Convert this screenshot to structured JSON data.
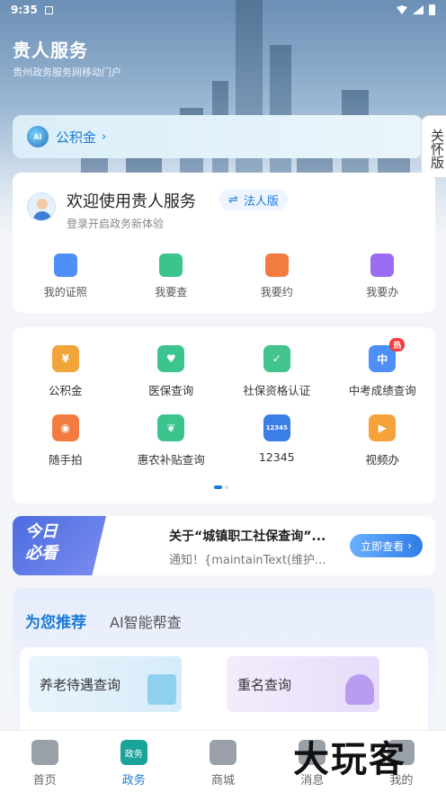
{
  "status_bar": {
    "time": "9:35",
    "notif_glyph": "A"
  },
  "header": {
    "title": "贵人服务",
    "subtitle": "贵州政务服务网移动门户"
  },
  "care_mode": {
    "label": "关怀版"
  },
  "fund_bar": {
    "ai_badge": "AI",
    "label": "公积金",
    "chevron": "›"
  },
  "welcome": {
    "title": "欢迎使用贵人服务",
    "legal_label": "法人版",
    "legal_icon": "⇌",
    "subtitle": "登录开启政务新体验",
    "quick": [
      {
        "label": "我的证照",
        "icon": "id-card-icon",
        "color": "#4e8ef7"
      },
      {
        "label": "我要查",
        "icon": "search-doc-icon",
        "color": "#3cc48f"
      },
      {
        "label": "我要约",
        "icon": "calendar-icon",
        "color": "#f27b3f"
      },
      {
        "label": "我要办",
        "icon": "task-icon",
        "color": "#9a6cf2"
      }
    ]
  },
  "services": {
    "items": [
      {
        "label": "公积金",
        "icon": "fund-icon",
        "glyph": "¥",
        "color": "#f0a43a"
      },
      {
        "label": "医保查询",
        "icon": "medical-card-icon",
        "glyph": "♥",
        "color": "#3cc48f"
      },
      {
        "label": "社保资格认证",
        "icon": "verify-icon",
        "glyph": "✓",
        "color": "#43c48c"
      },
      {
        "label": "中考成绩查询",
        "icon": "exam-score-icon",
        "glyph": "中",
        "color": "#4e8ef7",
        "badge": "热"
      },
      {
        "label": "随手拍",
        "icon": "camera-icon",
        "glyph": "◉",
        "color": "#f27b3f"
      },
      {
        "label": "惠农补贴查询",
        "icon": "plant-icon",
        "glyph": "❦",
        "color": "#3cc48f"
      },
      {
        "label": "12345",
        "icon": "hotline-icon",
        "glyph": "12345",
        "color": "#3c7ee8"
      },
      {
        "label": "视频办",
        "icon": "video-icon",
        "glyph": "▶",
        "color": "#f5a23a"
      }
    ]
  },
  "today": {
    "badge_line1": "今日",
    "badge_line2": "必看",
    "title": "关于“城镇职工社保查询”...",
    "text": "通知！{maintainText(维护...",
    "button": "立即查看",
    "button_chev": "›"
  },
  "recommend": {
    "tab_active": "为您推荐",
    "tab_other": "AI智能帮查",
    "cards": [
      {
        "label": "养老待遇查询",
        "icon": "pension-icon"
      },
      {
        "label": "重名查询",
        "icon": "person-search-icon"
      }
    ]
  },
  "tabbar": {
    "items": [
      {
        "label": "首页",
        "icon": "home-icon"
      },
      {
        "label": "政务",
        "icon": "gov-icon",
        "glyph": "政务"
      },
      {
        "label": "商城",
        "icon": "store-icon"
      },
      {
        "label": "消息",
        "icon": "message-icon"
      },
      {
        "label": "我的",
        "icon": "profile-icon"
      }
    ],
    "active_index": 1
  },
  "watermark": "大玩客"
}
